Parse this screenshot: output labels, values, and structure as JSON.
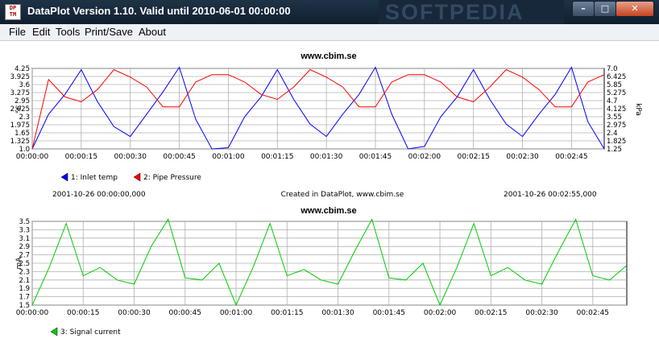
{
  "window": {
    "title": "DataPlot Version 1.10. Valid until 2010-06-01 00:00:00",
    "icon_text": "DP TM",
    "watermark": "SOFTPEDIA",
    "controls": {
      "minimize": "–",
      "maximize": "□",
      "close": "✕"
    }
  },
  "menu": {
    "file": "File",
    "edit": "Edit",
    "tools": "Tools",
    "print_save": "Print/Save",
    "about": "About"
  },
  "plot1": {
    "title": "www.cbim.se",
    "left_unit": "°C",
    "right_unit": "kPa",
    "footer_left": "2001-10-26 00:00:00,000",
    "footer_center": "Created in DataPlot, www.cbim.se",
    "footer_right": "2001-10-26 00:02:55,000",
    "legend": [
      {
        "label": "1: Inlet temp",
        "color": "#0000ff"
      },
      {
        "label": "2: Pipe Pressure",
        "color": "#ff0000"
      }
    ]
  },
  "plot2": {
    "title": "www.cbim.se",
    "left_unit": "mA",
    "legend": [
      {
        "label": "3: Signal current",
        "color": "#00cc00"
      }
    ]
  },
  "chart_data": [
    {
      "type": "line",
      "title": "www.cbim.se",
      "x": [
        0,
        5,
        10,
        15,
        20,
        25,
        30,
        35,
        40,
        45,
        50,
        55,
        60,
        65,
        70,
        75,
        80,
        85,
        90,
        95,
        100,
        105,
        110,
        115,
        120,
        125,
        130,
        135,
        140,
        145,
        150,
        155,
        160,
        165,
        170,
        175
      ],
      "x_ticks": [
        "00:00:00",
        "00:00:15",
        "00:00:30",
        "00:00:45",
        "00:01:00",
        "00:01:15",
        "00:01:30",
        "00:01:45",
        "00:02:00",
        "00:02:15",
        "00:02:30",
        "00:02:45"
      ],
      "y_left_ticks": [
        "1.0",
        "1.325",
        "1.65",
        "1.975",
        "2.3",
        "2.625",
        "2.95",
        "3.275",
        "3.6",
        "3.925",
        "4.25"
      ],
      "y_right_ticks": [
        "1.25",
        "1.825",
        "2.4",
        "2.975",
        "3.55",
        "4.125",
        "4.7",
        "5.275",
        "5.85",
        "6.425",
        "7.0"
      ],
      "ylim_left": [
        1.0,
        4.25
      ],
      "ylim_right": [
        1.25,
        7.0
      ],
      "series": [
        {
          "name": "1: Inlet temp",
          "color": "#0000ff",
          "axis": "left",
          "values": [
            1.0,
            2.4,
            3.2,
            4.2,
            2.9,
            1.9,
            1.5,
            2.4,
            3.3,
            4.3,
            2.2,
            1.0,
            1.05,
            2.3,
            3.1,
            4.2,
            3.0,
            2.0,
            1.5,
            2.4,
            3.2,
            4.3,
            2.4,
            1.0,
            1.1,
            2.3,
            3.1,
            4.2,
            3.0,
            2.0,
            1.5,
            2.4,
            3.2,
            4.3,
            2.1,
            1.0
          ]
        },
        {
          "name": "2: Pipe Pressure",
          "color": "#ff0000",
          "axis": "left",
          "values": [
            1.0,
            3.8,
            3.1,
            2.9,
            3.4,
            4.2,
            3.9,
            3.5,
            2.7,
            2.7,
            3.7,
            4.0,
            4.0,
            3.7,
            3.2,
            3.0,
            3.5,
            4.2,
            3.9,
            3.5,
            2.7,
            2.7,
            3.7,
            4.0,
            4.0,
            3.7,
            3.1,
            2.9,
            3.5,
            4.2,
            3.9,
            3.4,
            2.7,
            2.7,
            3.7,
            4.0
          ]
        }
      ]
    },
    {
      "type": "line",
      "title": "www.cbim.se",
      "x": [
        0,
        5,
        10,
        15,
        20,
        25,
        30,
        35,
        40,
        45,
        50,
        55,
        60,
        65,
        70,
        75,
        80,
        85,
        90,
        95,
        100,
        105,
        110,
        115,
        120,
        125,
        130,
        135,
        140,
        145,
        150,
        155,
        160,
        165,
        170,
        175
      ],
      "x_ticks": [
        "00:00:00",
        "00:00:15",
        "00:00:30",
        "00:00:45",
        "00:01:00",
        "00:01:15",
        "00:01:30",
        "00:01:45",
        "00:02:00",
        "00:02:15",
        "00:02:30",
        "00:02:45"
      ],
      "y_left_ticks": [
        "1.5",
        "1.7",
        "1.9",
        "2.1",
        "2.3",
        "2.5",
        "2.7",
        "2.9",
        "3.1",
        "3.3",
        "3.5"
      ],
      "ylim_left": [
        1.5,
        3.5
      ],
      "series": [
        {
          "name": "3: Signal current",
          "color": "#00cc00",
          "axis": "left",
          "values": [
            1.5,
            2.4,
            3.45,
            2.2,
            2.4,
            2.1,
            2.0,
            2.9,
            3.55,
            2.15,
            2.1,
            2.5,
            1.5,
            2.4,
            3.45,
            2.2,
            2.35,
            2.1,
            2.0,
            2.8,
            3.55,
            2.15,
            2.1,
            2.5,
            1.5,
            2.4,
            3.45,
            2.2,
            2.4,
            2.1,
            2.0,
            2.8,
            3.55,
            2.2,
            2.1,
            2.45
          ]
        }
      ]
    }
  ]
}
